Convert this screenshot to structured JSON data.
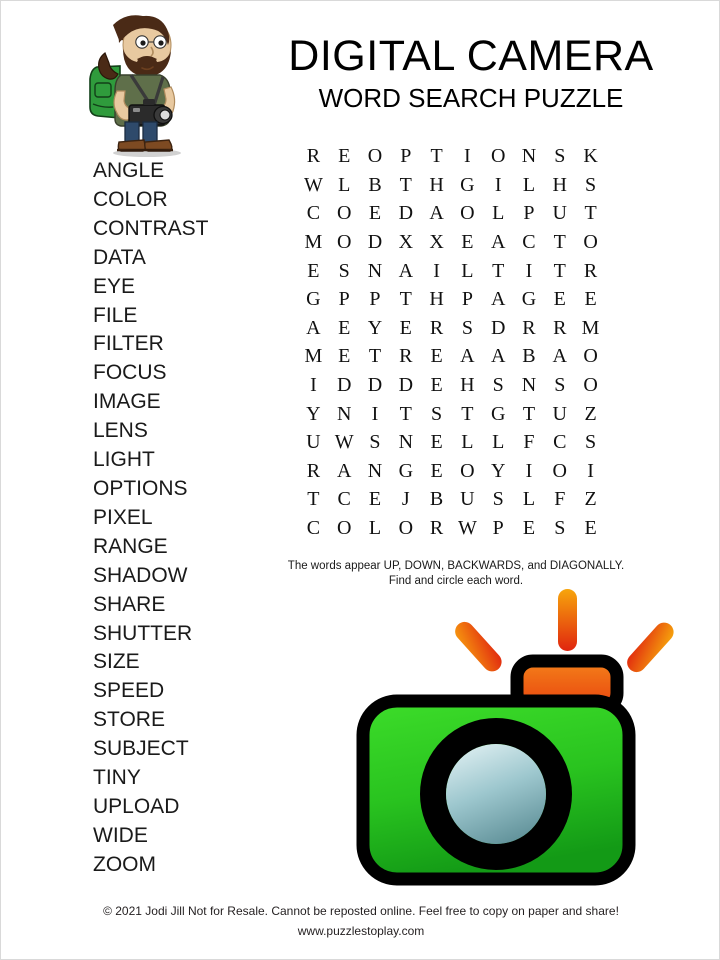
{
  "page": {
    "title": "DIGITAL CAMERA",
    "subtitle": "WORD SEARCH PUZZLE"
  },
  "words": [
    "ANGLE",
    "COLOR",
    "CONTRAST",
    "DATA",
    "EYE",
    "FILE",
    "FILTER",
    "FOCUS",
    "IMAGE",
    "LENS",
    "LIGHT",
    "OPTIONS",
    "PIXEL",
    "RANGE",
    "SHADOW",
    "SHARE",
    "SHUTTER",
    "SIZE",
    "SPEED",
    "STORE",
    "SUBJECT",
    "TINY",
    "UPLOAD",
    "WIDE",
    "ZOOM"
  ],
  "grid": {
    "rows": 14,
    "cols": 10,
    "letters": [
      [
        "R",
        "E",
        "O",
        "P",
        "T",
        "I",
        "O",
        "N",
        "S",
        "K"
      ],
      [
        "W",
        "L",
        "B",
        "T",
        "H",
        "G",
        "I",
        "L",
        "H",
        "S"
      ],
      [
        "C",
        "O",
        "E",
        "D",
        "A",
        "O",
        "L",
        "P",
        "U",
        "T"
      ],
      [
        "M",
        "O",
        "D",
        "X",
        "X",
        "E",
        "A",
        "C",
        "T",
        "O"
      ],
      [
        "E",
        "S",
        "N",
        "A",
        "I",
        "L",
        "T",
        "I",
        "T",
        "R"
      ],
      [
        "G",
        "P",
        "P",
        "T",
        "H",
        "P",
        "A",
        "G",
        "E",
        "E"
      ],
      [
        "A",
        "E",
        "Y",
        "E",
        "R",
        "S",
        "D",
        "R",
        "R",
        "M"
      ],
      [
        "M",
        "E",
        "T",
        "R",
        "E",
        "A",
        "A",
        "B",
        "A",
        "O"
      ],
      [
        "I",
        "D",
        "D",
        "D",
        "E",
        "H",
        "S",
        "N",
        "S",
        "O"
      ],
      [
        "Y",
        "N",
        "I",
        "T",
        "S",
        "T",
        "G",
        "T",
        "U",
        "Z"
      ],
      [
        "U",
        "W",
        "S",
        "N",
        "E",
        "L",
        "L",
        "F",
        "C",
        "S"
      ],
      [
        "R",
        "A",
        "N",
        "G",
        "E",
        "O",
        "Y",
        "I",
        "O",
        "I"
      ],
      [
        "T",
        "C",
        "E",
        "J",
        "B",
        "U",
        "S",
        "L",
        "F",
        "Z"
      ],
      [
        "C",
        "O",
        "L",
        "O",
        "R",
        "W",
        "P",
        "E",
        "S",
        "E"
      ]
    ]
  },
  "instructions": {
    "line1": "The words appear UP, DOWN, BACKWARDS, and DIAGONALLY.",
    "line2": "Find and circle each word."
  },
  "footer": {
    "copyright": "© 2021  Jodi Jill Not for Resale. Cannot be reposted online. Feel free to copy on paper and share!",
    "website": "www.puzzlestoplay.com"
  },
  "colors": {
    "camera_body_light": "#3ddd2a",
    "camera_body_dark": "#169c18",
    "camera_outline": "#000000",
    "lens_light": "#cfe3e6",
    "lens_dark": "#5f9ea3",
    "flash_orange": "#f59a12",
    "flash_red": "#e8301a",
    "flash_top": "#ef7d16",
    "backpack_green": "#2f9b3c",
    "shirt_green": "#5f6f4a",
    "jeans_blue": "#2e4a6b",
    "boots_brown": "#7d4a22",
    "hair_brown": "#4a2a16",
    "skin": "#e8c9a0",
    "text_black": "#000000"
  }
}
